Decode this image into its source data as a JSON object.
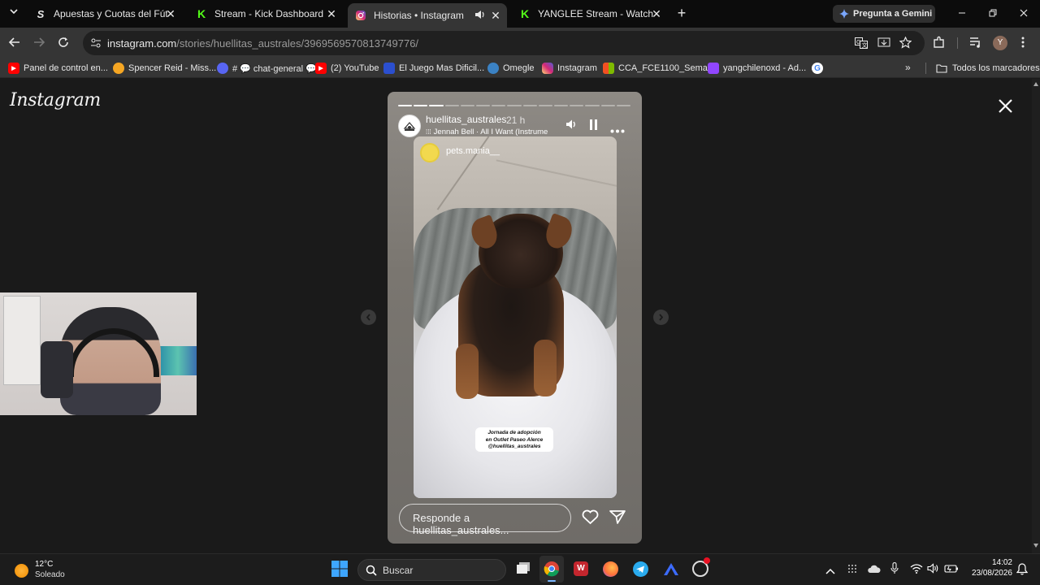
{
  "tabs": [
    {
      "title": "Apuestas y Cuotas del Fútbol de",
      "active": false
    },
    {
      "title": "Stream - Kick Dashboard",
      "active": false
    },
    {
      "title": "Historias • Instagram",
      "active": true
    },
    {
      "title": "YANGLEE Stream - Watch Live o",
      "active": false
    }
  ],
  "gemini_label": "Pregunta a Gemini",
  "url": {
    "domain": "instagram.com",
    "path": "/stories/huellitas_australes/3969569570813749776/"
  },
  "bookmarks": [
    {
      "label": "Panel de control en..."
    },
    {
      "label": "Spencer Reid - Miss..."
    },
    {
      "label": "# 💬 chat-general 💬"
    },
    {
      "label": "(2) YouTube"
    },
    {
      "label": "El Juego Mas Dificil..."
    },
    {
      "label": "Omegle"
    },
    {
      "label": "Instagram"
    },
    {
      "label": "CCA_FCE1100_Sema..."
    },
    {
      "label": "yangchilenoxd - Ad..."
    }
  ],
  "bookmarks_folder": "Todos los marcadores",
  "brand": "Instagram",
  "story": {
    "username": "huellitas_australes",
    "time": "21 h",
    "music": "Jennah Bell · All I Want (Instrume",
    "reshared_user": "pets.mania__",
    "sticker_line1": "Jornada de adopción",
    "sticker_line2": "en Outlet Paseo Alerce",
    "sticker_line3": "@huellitas_australes",
    "reply_placeholder": "Responde a huellitas_australes...",
    "segments_total": 15,
    "segments_done": 3
  },
  "weather": {
    "temp": "12°C",
    "cond": "Soleado"
  },
  "taskbar_search": "Buscar",
  "clock": {
    "time": "14:02",
    "date": "23/08/2026"
  },
  "colors": {
    "accent": "#1a73e8",
    "kick_green": "#53fc18",
    "page_bg": "#1a1a1a"
  }
}
